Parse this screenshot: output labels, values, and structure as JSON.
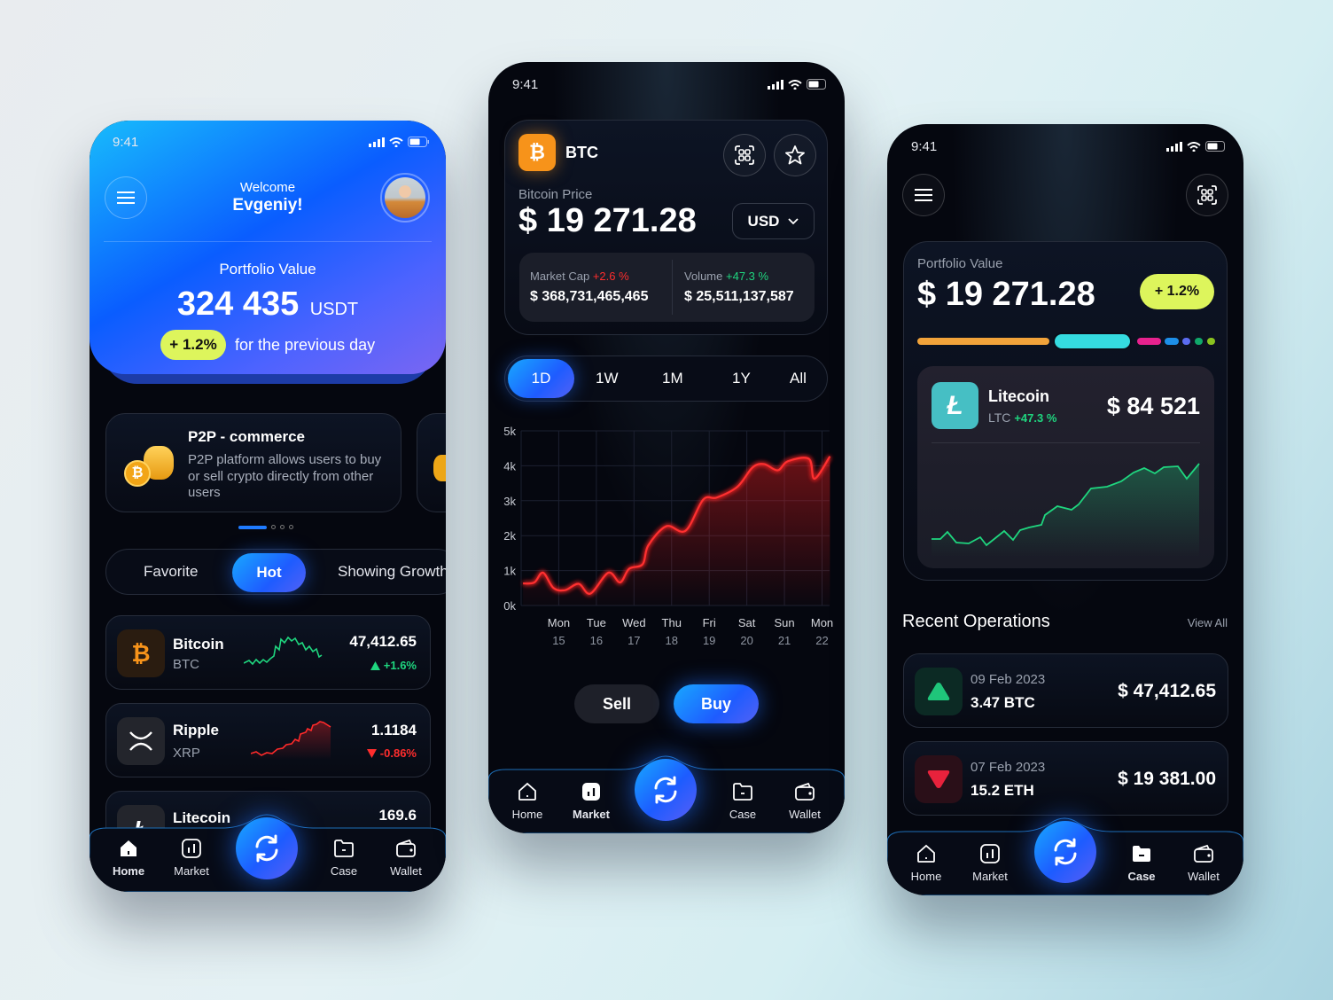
{
  "status_time": "9:41",
  "nav": {
    "home": "Home",
    "market": "Market",
    "case": "Case",
    "wallet": "Wallet"
  },
  "home_screen": {
    "welcome": "Welcome",
    "user_name": "Evgeniy!",
    "portfolio_label": "Portfolio Value",
    "portfolio_value": "324 435",
    "portfolio_currency": "USDT",
    "change_badge": "+ 1.2%",
    "change_caption": "for the previous day",
    "promo": {
      "title": "P2P - commerce",
      "body": "P2P platform allows users to buy or sell crypto directly from other users"
    },
    "carousel_pages": 4,
    "carousel_active": 1,
    "tabs": [
      {
        "label": "Favorite",
        "active": false
      },
      {
        "label": "Hot",
        "active": true
      },
      {
        "label": "Showing Growth",
        "active": false
      }
    ],
    "coins": [
      {
        "name": "Bitcoin",
        "symbol": "BTC",
        "price": "47,412.65",
        "change": "+1.6%",
        "trend": "up"
      },
      {
        "name": "Ripple",
        "symbol": "XRP",
        "price": "1.1184",
        "change": "-0.86%",
        "trend": "down"
      },
      {
        "name": "Litecoin",
        "symbol": "LTC",
        "price": "169.6",
        "trend": "up"
      }
    ]
  },
  "market_screen": {
    "ticker": "BTC",
    "price_label": "Bitcoin Price",
    "price": "$ 19 271.28",
    "currency": "USD",
    "market_cap_label": "Market Cap",
    "market_cap_change": "+2.6 %",
    "market_cap_value": "$ 368,731,465,465",
    "volume_label": "Volume",
    "volume_change": "+47.3 %",
    "volume_value": "$ 25,511,137,587",
    "timeframes": [
      {
        "label": "1D",
        "active": true
      },
      {
        "label": "1W"
      },
      {
        "label": "1M"
      },
      {
        "label": "1Y"
      },
      {
        "label": "All"
      }
    ],
    "sell_label": "Sell",
    "buy_label": "Buy"
  },
  "chart_data": {
    "type": "area",
    "ylim": [
      0,
      5000
    ],
    "xlim": [
      14,
      22.2
    ],
    "y_ticks": [
      "0k",
      "1k",
      "2k",
      "3k",
      "4k",
      "5k"
    ],
    "x_ticks": [
      {
        "day": "Mon",
        "date": "15",
        "x": 15
      },
      {
        "day": "Tue",
        "date": "16",
        "x": 16
      },
      {
        "day": "Wed",
        "date": "17",
        "x": 17
      },
      {
        "day": "Thu",
        "date": "18",
        "x": 18
      },
      {
        "day": "Fri",
        "date": "19",
        "x": 19
      },
      {
        "day": "Sat",
        "date": "20",
        "x": 20
      },
      {
        "day": "Sun",
        "date": "21",
        "x": 21
      },
      {
        "day": "Mon",
        "date": "22",
        "x": 22
      }
    ],
    "grid": true,
    "color": "#ff2020",
    "points": [
      [
        14.05,
        630
      ],
      [
        14.35,
        660
      ],
      [
        14.58,
        940
      ],
      [
        14.86,
        500
      ],
      [
        15.17,
        440
      ],
      [
        15.53,
        620
      ],
      [
        15.84,
        340
      ],
      [
        16.32,
        940
      ],
      [
        16.63,
        660
      ],
      [
        16.87,
        1050
      ],
      [
        17.23,
        1180
      ],
      [
        17.38,
        1720
      ],
      [
        17.86,
        2270
      ],
      [
        18.37,
        2140
      ],
      [
        18.84,
        3030
      ],
      [
        19.2,
        3090
      ],
      [
        19.75,
        3400
      ],
      [
        20.15,
        3950
      ],
      [
        20.46,
        4050
      ],
      [
        20.82,
        3870
      ],
      [
        21.09,
        4130
      ],
      [
        21.65,
        4200
      ],
      [
        21.8,
        3630
      ],
      [
        22.21,
        4270
      ]
    ]
  },
  "portfolio_screen": {
    "portfolio_label": "Portfolio Value",
    "portfolio_value": "$ 19 271.28",
    "change_badge": "+ 1.2%",
    "allocation_colors": [
      "#f2a33a",
      "#35dbe0",
      "#e8228e",
      "#1d8fe8",
      "#5b6cf0",
      "#10a86a",
      "#8ac21f"
    ],
    "selected": {
      "name": "Litecoin",
      "symbol": "LTC",
      "change": "+47.3 %",
      "value": "$ 84 521"
    },
    "recent_title": "Recent Operations",
    "view_all": "View All",
    "operations": [
      {
        "date": "09 Feb 2023",
        "amount": "3.47 BTC",
        "value": "$ 47,412.65",
        "type": "up"
      },
      {
        "date": "07 Feb 2023",
        "amount": "15.2 ETH",
        "value": "$ 19 381.00",
        "type": "down"
      }
    ]
  }
}
